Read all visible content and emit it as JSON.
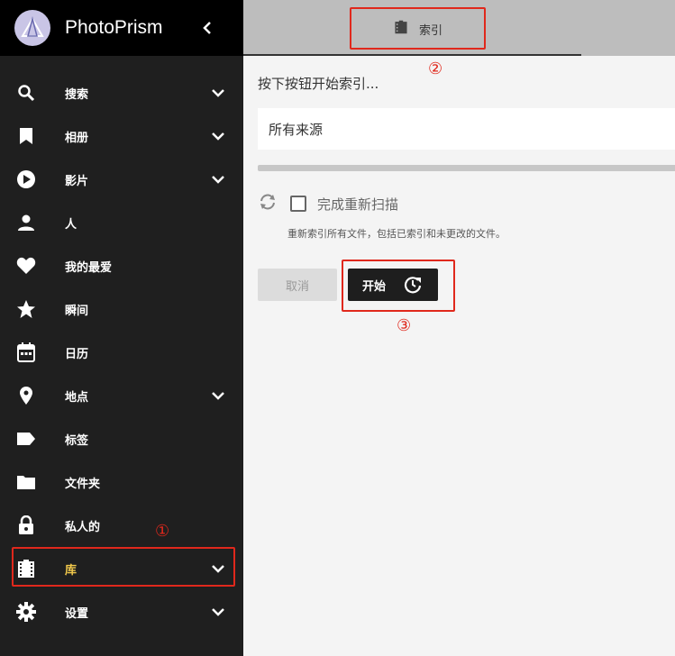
{
  "app": {
    "title": "PhotoPrism",
    "logo_icon": "photoprism-logo-icon",
    "collapse_icon": "chevron-left-icon"
  },
  "sidebar": {
    "items": [
      {
        "label": "搜索",
        "icon": "search-icon",
        "has_chevron": true
      },
      {
        "label": "相册",
        "icon": "bookmark-icon",
        "has_chevron": true
      },
      {
        "label": "影片",
        "icon": "play-circle-icon",
        "has_chevron": true
      },
      {
        "label": "人",
        "icon": "person-icon",
        "has_chevron": false
      },
      {
        "label": "我的最爱",
        "icon": "heart-icon",
        "has_chevron": false
      },
      {
        "label": "瞬间",
        "icon": "star-icon",
        "has_chevron": false
      },
      {
        "label": "日历",
        "icon": "calendar-icon",
        "has_chevron": false
      },
      {
        "label": "地点",
        "icon": "location-pin-icon",
        "has_chevron": true
      },
      {
        "label": "标签",
        "icon": "label-icon",
        "has_chevron": false
      },
      {
        "label": "文件夹",
        "icon": "folder-icon",
        "has_chevron": false
      },
      {
        "label": "私人的",
        "icon": "lock-icon",
        "has_chevron": false
      },
      {
        "label": "库",
        "icon": "film-library-icon",
        "has_chevron": true,
        "active": true
      },
      {
        "label": "设置",
        "icon": "gear-icon",
        "has_chevron": true
      }
    ],
    "active_color": "#f2c94c"
  },
  "tabs": [
    {
      "label": "索引",
      "icon": "film-library-icon",
      "active": true
    }
  ],
  "main": {
    "hint": "按下按钮开始索引...",
    "source_select": {
      "value": "所有来源"
    },
    "progress": 0,
    "rescan": {
      "icon": "sync-icon",
      "label": "完成重新扫描",
      "checked": false,
      "hint": "重新索引所有文件，包括已索引和未更改的文件。"
    },
    "buttons": {
      "cancel": "取消",
      "start": "开始",
      "start_icon": "refresh-clock-icon"
    }
  },
  "annotations": {
    "marker1": "①",
    "marker2": "②",
    "marker3": "③",
    "color": "#e0281c"
  }
}
